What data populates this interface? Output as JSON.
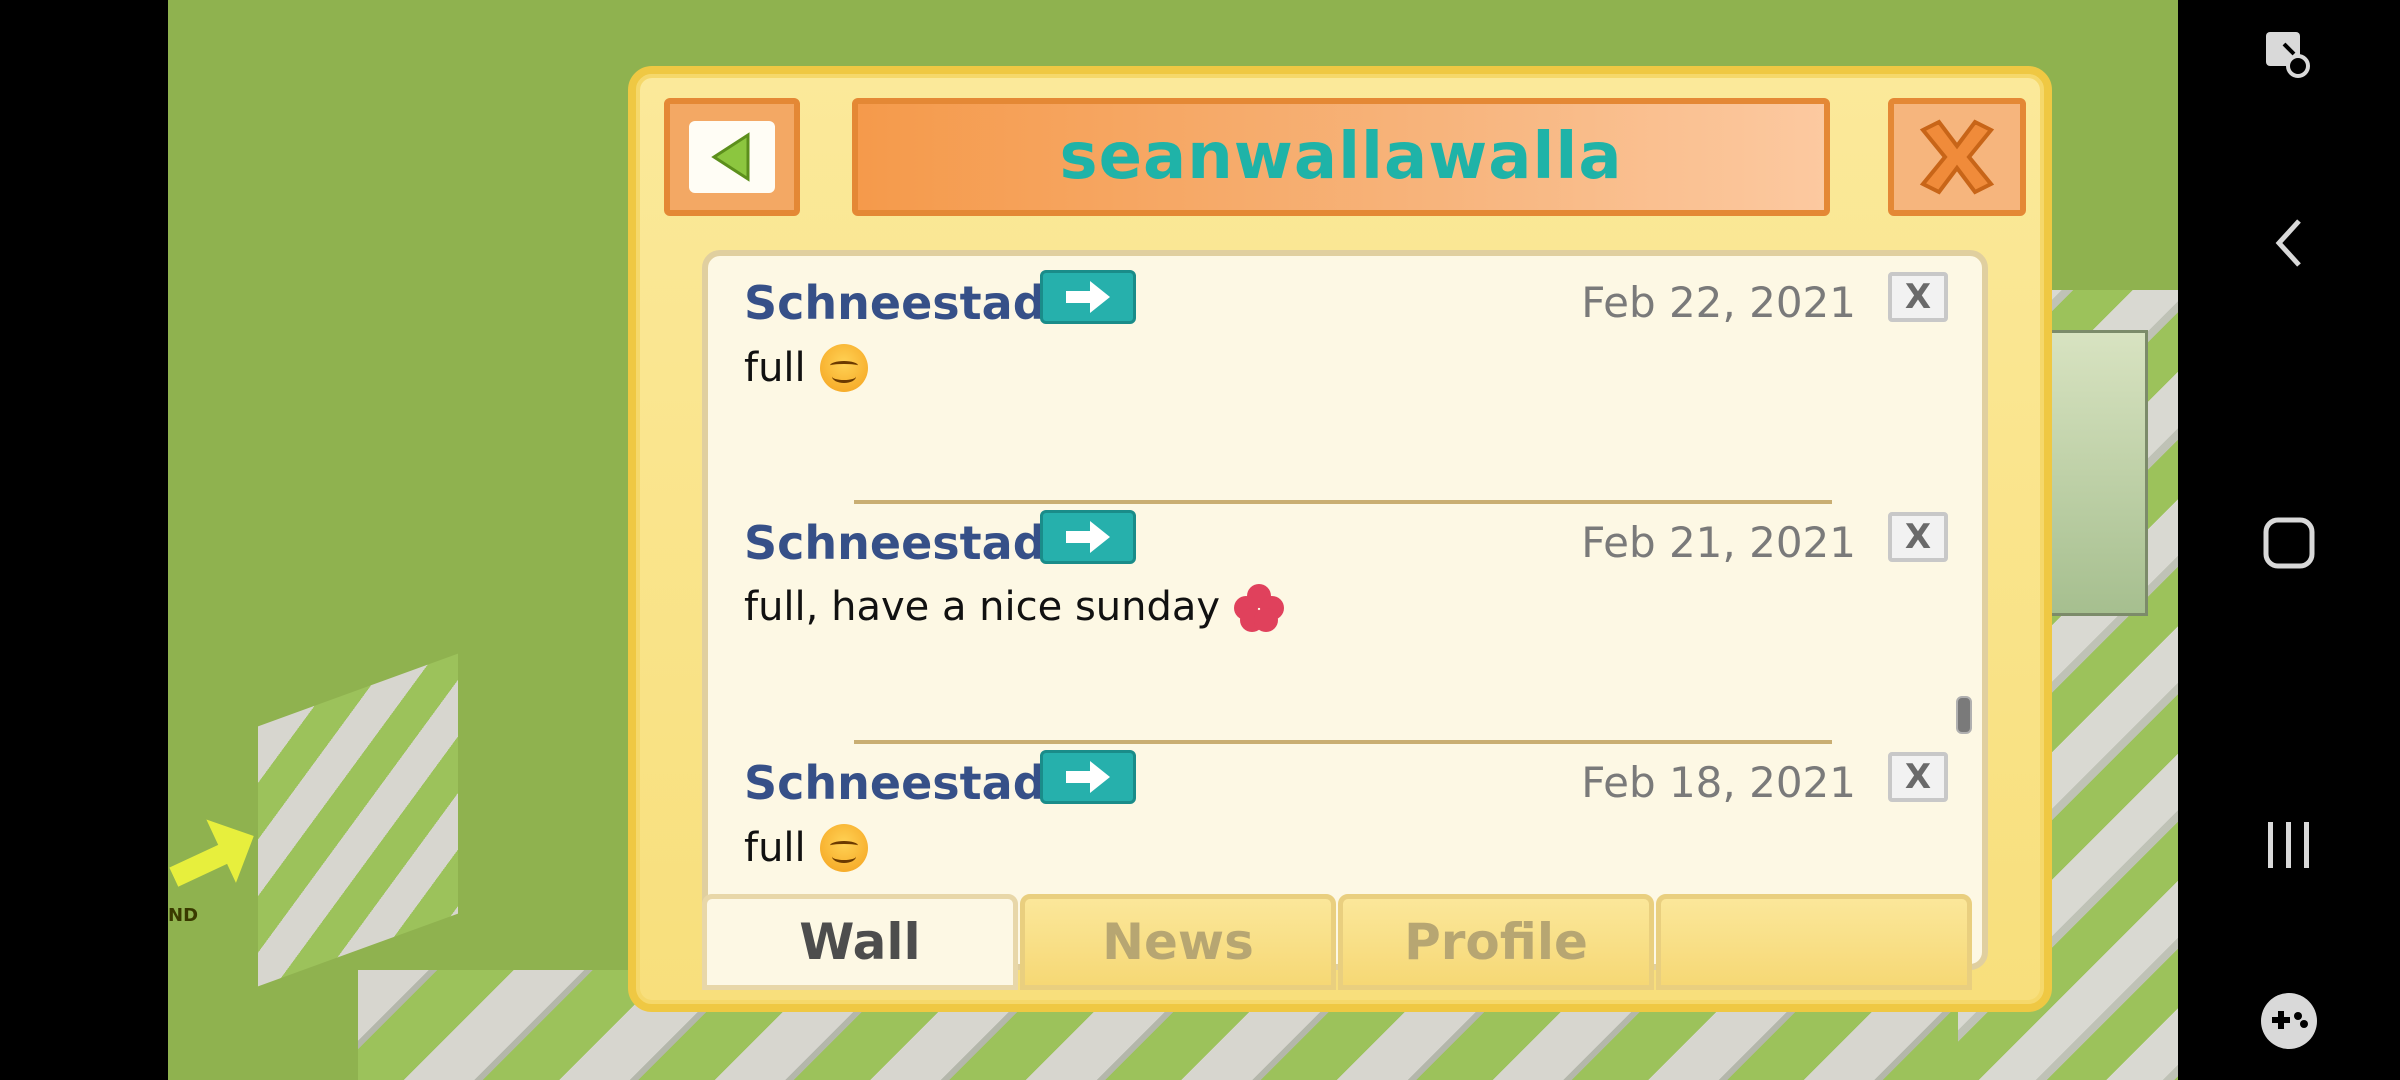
{
  "dialog": {
    "title": "seanwallawalla",
    "close_glyph": "X"
  },
  "posts": [
    {
      "author": "Schneestadt",
      "date": "Feb 22, 2021",
      "message": "full",
      "emoji": "smile-emoji",
      "delete": "X"
    },
    {
      "author": "Schneestadt",
      "date": "Feb 21, 2021",
      "message": "full, have a nice sunday",
      "emoji": "hibiscus-emoji",
      "delete": "X"
    },
    {
      "author": "Schneestadt",
      "date": "Feb 18, 2021",
      "message": "full",
      "emoji": "smile-emoji",
      "delete": "X"
    }
  ],
  "tabs": [
    {
      "label": "Wall",
      "active": true
    },
    {
      "label": "News",
      "active": false
    },
    {
      "label": "Profile",
      "active": false
    },
    {
      "label": "",
      "active": false
    }
  ],
  "game": {
    "sign_text": "ND"
  },
  "navbar": {
    "icons": [
      "screen-capture-icon",
      "back-icon",
      "home-icon",
      "recents-icon",
      "game-tools-icon"
    ]
  },
  "colors": {
    "title_text": "#1fb3a8",
    "author_text": "#365088",
    "dialog_bg": "#fbe99a",
    "accent_orange": "#f59a4b"
  }
}
